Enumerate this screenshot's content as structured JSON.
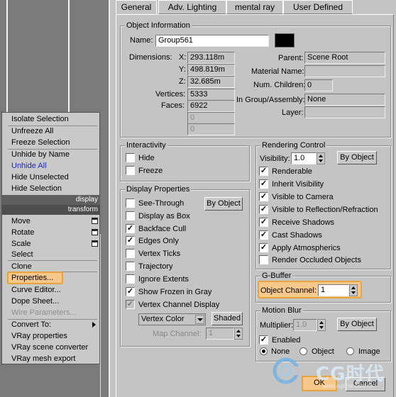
{
  "quad_menu": {
    "top_items": [
      "Isolate Selection",
      "Unfreeze All",
      "Freeze Selection",
      "Unhide by Name",
      "Unhide All",
      "Hide Unselected",
      "Hide Selection"
    ],
    "display_header": "display",
    "transform_header": "transform",
    "transform_items": [
      "Move",
      "Rotate",
      "Scale",
      "Select"
    ],
    "clone": "Clone",
    "properties": "Properties...",
    "curve_editor": "Curve Editor...",
    "dope_sheet": "Dope Sheet...",
    "wire_parameters": "Wire Parameters...",
    "convert_to": "Convert To:",
    "vray_properties": "VRay properties",
    "vray_scene_converter": "VRay scene converter",
    "vray_mesh_export": "VRay mesh export"
  },
  "tabs": [
    "General",
    "Adv. Lighting",
    "mental ray",
    "User Defined"
  ],
  "object_info": {
    "title": "Object Information",
    "name_label": "Name:",
    "name": "Group561",
    "dimensions_label": "Dimensions:",
    "x_label": "X:",
    "x": "293.118m",
    "y_label": "Y:",
    "y": "498.819m",
    "z_label": "Z:",
    "z": "32.685m",
    "vertices_label": "Vertices:",
    "vertices": "5333",
    "faces_label": "Faces:",
    "faces": "6922",
    "extra1": "0",
    "extra2": "0",
    "parent_label": "Parent:",
    "parent": "Scene Root",
    "material_label": "Material Name:",
    "material": "",
    "children_label": "Num. Children:",
    "children": "0",
    "group_label": "In Group/Assembly:",
    "group": "None",
    "layer_label": "Layer:",
    "layer": ""
  },
  "interactivity": {
    "title": "Interactivity",
    "hide": "Hide",
    "freeze": "Freeze"
  },
  "display_props": {
    "title": "Display Properties",
    "see_through": "See-Through",
    "by_object": "By Object",
    "display_as_box": "Display as Box",
    "backface_cull": "Backface Cull",
    "edges_only": "Edges Only",
    "vertex_ticks": "Vertex Ticks",
    "trajectory": "Trajectory",
    "ignore_extents": "Ignore Extents",
    "show_frozen_gray": "Show Frozen in Gray",
    "vertex_channel_display": "Vertex Channel Display",
    "vertex_color": "Vertex Color",
    "shaded": "Shaded",
    "map_channel_label": "Map Channel:",
    "map_channel": "1"
  },
  "rendering_control": {
    "title": "Rendering Control",
    "visibility_label": "Visibility:",
    "visibility": "1.0",
    "by_object": "By Object",
    "renderable": "Renderable",
    "inherit_visibility": "Inherit Visibility",
    "visible_to_camera": "Visible to Camera",
    "visible_to_reflection": "Visible to Reflection/Refraction",
    "receive_shadows": "Receive Shadows",
    "cast_shadows": "Cast Shadows",
    "apply_atmospherics": "Apply Atmospherics",
    "render_occluded": "Render Occluded Objects"
  },
  "gbuffer": {
    "title": "G-Buffer",
    "object_channel_label": "Object Channel:",
    "object_channel": "1"
  },
  "motion_blur": {
    "title": "Motion Blur",
    "multiplier_label": "Multiplier:",
    "multiplier": "1.0",
    "by_object": "By Object",
    "enabled": "Enabled",
    "none": "None",
    "object": "Object",
    "image": "Image"
  },
  "footer": {
    "ok": "OK",
    "cancel": "Cancel",
    "watermark": "CG时代",
    "watermark_url": "www.cgtime.com.cn"
  },
  "colors": {
    "highlight": "#e8a33c",
    "swatch": "#000000",
    "dialog_bg": "#c4c4c4",
    "viewport": "#7a7a7a"
  }
}
